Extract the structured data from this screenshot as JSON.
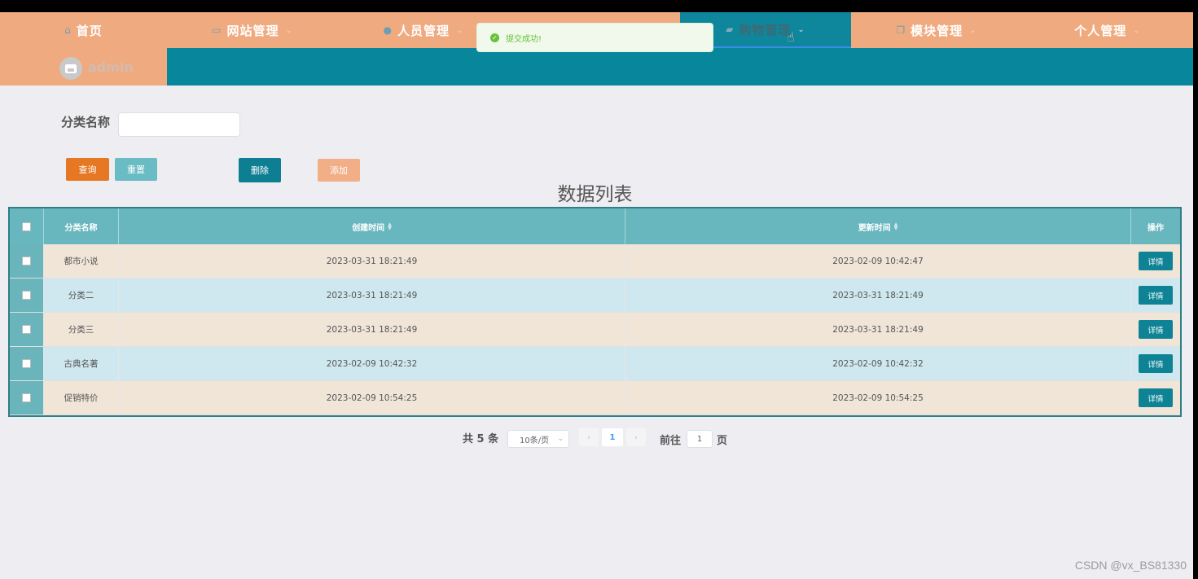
{
  "nav": {
    "items": [
      {
        "label": "首页",
        "icon": "home-icon",
        "glyph": "⌂",
        "chevron": ""
      },
      {
        "label": "网站管理",
        "icon": "monitor-icon",
        "glyph": "▭",
        "chevron": "⌄"
      },
      {
        "label": "人员管理",
        "icon": "user-icon",
        "glyph": "●",
        "chevron": "⌄"
      },
      {
        "label": "购物管理",
        "icon": "bag-icon",
        "glyph": "▰",
        "chevron": "⌄"
      },
      {
        "label": "模块管理",
        "icon": "copy-icon",
        "glyph": "❐",
        "chevron": "⌄"
      },
      {
        "label": "个人管理",
        "icon": "",
        "glyph": "",
        "chevron": "⌄"
      }
    ],
    "active_index": 3
  },
  "user": {
    "name": "admin",
    "avatar_icon": "image-icon"
  },
  "toast": {
    "message": "提交成功!",
    "icon": "check-circle-icon"
  },
  "search": {
    "label": "分类名称",
    "value": "",
    "placeholder": ""
  },
  "buttons": {
    "query": "查询",
    "reset": "重置",
    "delete": "删除",
    "add": "添加"
  },
  "list_title": "数据列表",
  "table": {
    "columns": [
      "分类名称",
      "创建时间",
      "更新时间",
      "操作"
    ],
    "rows": [
      {
        "name": "都市小说",
        "created": "2023-03-31 18:21:49",
        "updated": "2023-02-09 10:42:47",
        "action": "详情"
      },
      {
        "name": "分类二",
        "created": "2023-03-31 18:21:49",
        "updated": "2023-03-31 18:21:49",
        "action": "详情"
      },
      {
        "name": "分类三",
        "created": "2023-03-31 18:21:49",
        "updated": "2023-03-31 18:21:49",
        "action": "详情"
      },
      {
        "name": "古典名著",
        "created": "2023-02-09 10:42:32",
        "updated": "2023-02-09 10:42:32",
        "action": "详情"
      },
      {
        "name": "促销特价",
        "created": "2023-02-09 10:54:25",
        "updated": "2023-02-09 10:54:25",
        "action": "详情"
      }
    ]
  },
  "pagination": {
    "total": "共 5 条",
    "page_size": "10条/页",
    "current_page": "1",
    "goto_label": "前往",
    "goto_value": "1",
    "page_suffix": "页"
  },
  "watermark": "CSDN @vx_BS81330",
  "colors": {
    "nav_bg": "#f0aa80",
    "teal": "#08879c",
    "orange": "#e67723",
    "success": "#67c23a"
  }
}
